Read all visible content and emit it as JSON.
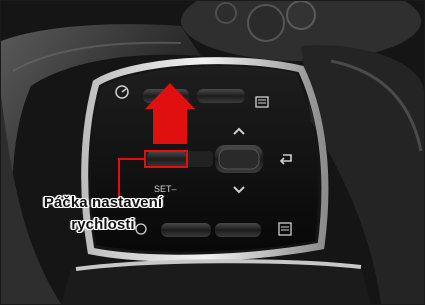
{
  "callout": {
    "line1": "Páčka nastavení",
    "line2": "rychlosti"
  },
  "panel_markings": {
    "set_label": "SET–"
  },
  "colors": {
    "arrow": "#e01010",
    "highlight": "#e01010",
    "callout_line": "#e01010"
  },
  "icons": [
    "cruise-control-icon",
    "distance-icon",
    "up-chevron-icon",
    "down-chevron-icon",
    "enter-icon",
    "lane-keep-icon",
    "display-icon"
  ]
}
